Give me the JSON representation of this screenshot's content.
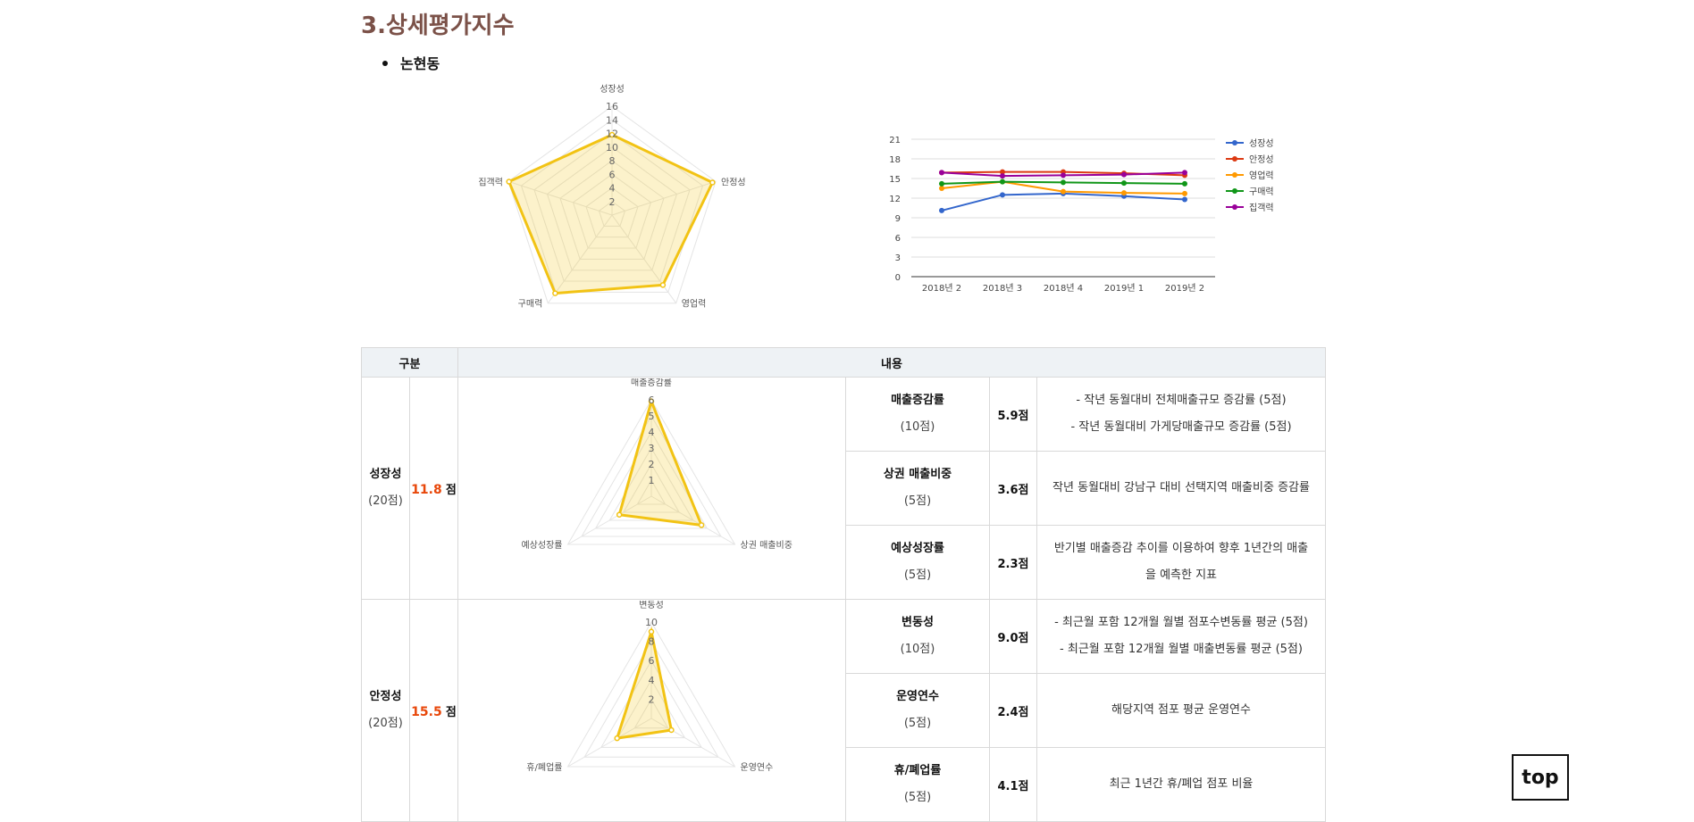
{
  "section": {
    "title": "3.상세평가지수",
    "area": "논현동"
  },
  "radar_main": {
    "axes": [
      "성장성",
      "안정성",
      "영업력",
      "구매력",
      "집객력"
    ],
    "ticks": [
      "2",
      "4",
      "6",
      "8",
      "10",
      "12",
      "14",
      "16"
    ],
    "values": [
      11.8,
      15.5,
      12.7,
      14.2,
      15.9
    ],
    "max": 16,
    "color": "#f2c314"
  },
  "chart_data": {
    "type": "line",
    "categories": [
      "2018년 2",
      "2018년 3",
      "2018년 4",
      "2019년 1",
      "2019년 2"
    ],
    "ylim": [
      0,
      21
    ],
    "yticks": [
      "0",
      "3",
      "6",
      "9",
      "12",
      "15",
      "18",
      "21"
    ],
    "series": [
      {
        "name": "성장성",
        "color": "#3366cc",
        "values": [
          10.1,
          12.5,
          12.7,
          12.3,
          11.8
        ]
      },
      {
        "name": "안정성",
        "color": "#dc3912",
        "values": [
          15.9,
          16.0,
          16.0,
          15.8,
          15.5
        ]
      },
      {
        "name": "영업력",
        "color": "#ff9900",
        "values": [
          13.5,
          14.5,
          13.0,
          12.8,
          12.7
        ]
      },
      {
        "name": "구매력",
        "color": "#109618",
        "values": [
          14.2,
          14.5,
          14.4,
          14.3,
          14.2
        ]
      },
      {
        "name": "집객력",
        "color": "#990099",
        "values": [
          15.9,
          15.4,
          15.5,
          15.6,
          15.9
        ]
      }
    ],
    "legend": "right"
  },
  "table": {
    "header": {
      "col1": "구분",
      "col2": "내용"
    },
    "categories": [
      {
        "name": "성장성",
        "max": "(20점)",
        "score": "11.8",
        "unit": "점",
        "radar": {
          "axes": [
            "매출증감률",
            "상권 매출비중",
            "예상성장률"
          ],
          "ticks": [
            "1",
            "2",
            "3",
            "4",
            "5",
            "6"
          ],
          "max": 6,
          "values": [
            5.9,
            3.6,
            2.3
          ]
        },
        "items": [
          {
            "name": "매출증감률",
            "max": "(10점)",
            "score": "5.9점",
            "desc": [
              "- 작년 동월대비 전체매출규모 증감률 (5점)",
              "- 작년 동월대비 가게당매출규모 증감률 (5점)"
            ]
          },
          {
            "name": "상권 매출비중",
            "max": "(5점)",
            "score": "3.6점",
            "desc": [
              "작년 동월대비 강남구 대비 선택지역 매출비중 증감률"
            ]
          },
          {
            "name": "예상성장률",
            "max": "(5점)",
            "score": "2.3점",
            "desc": [
              "반기별 매출증감 추이를 이용하여 향후 1년간의 매출",
              "을 예측한 지표"
            ]
          }
        ]
      },
      {
        "name": "안정성",
        "max": "(20점)",
        "score": "15.5",
        "unit": "점",
        "radar": {
          "axes": [
            "변동성",
            "운영연수",
            "휴/폐업률"
          ],
          "ticks": [
            "2",
            "4",
            "6",
            "8",
            "10"
          ],
          "max": 10,
          "values": [
            9.0,
            2.4,
            4.1
          ]
        },
        "items": [
          {
            "name": "변동성",
            "max": "(10점)",
            "score": "9.0점",
            "desc": [
              "- 최근월 포함 12개월 월별 점포수변동률 평균 (5점)",
              "- 최근월 포함 12개월 월별 매출변동률 평균 (5점)"
            ]
          },
          {
            "name": "운영연수",
            "max": "(5점)",
            "score": "2.4점",
            "desc": [
              "해당지역 점포 평균 운영연수"
            ]
          },
          {
            "name": "휴/폐업률",
            "max": "(5점)",
            "score": "4.1점",
            "desc": [
              "최근 1년간 휴/폐업 점포 비율"
            ]
          }
        ]
      }
    ]
  },
  "top_button": "top"
}
